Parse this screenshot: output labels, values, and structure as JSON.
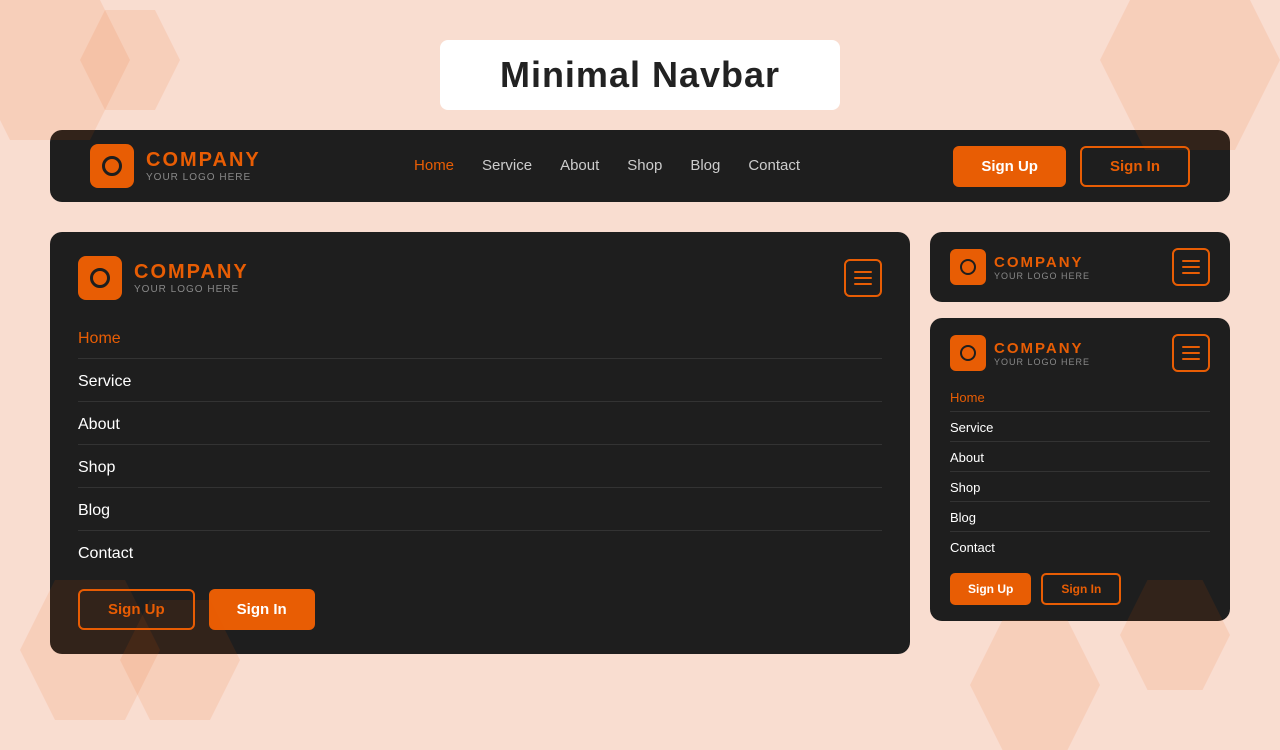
{
  "page": {
    "title": "Minimal Navbar",
    "background": "#f9ddd0"
  },
  "brand": {
    "name": "COMPANY",
    "sub": "YOUR LOGO HERE"
  },
  "nav": {
    "links": [
      {
        "label": "Home",
        "active": true
      },
      {
        "label": "Service",
        "active": false
      },
      {
        "label": "About",
        "active": false
      },
      {
        "label": "Shop",
        "active": false
      },
      {
        "label": "Blog",
        "active": false
      },
      {
        "label": "Contact",
        "active": false
      }
    ],
    "signup": "Sign Up",
    "signin": "Sign In"
  },
  "mobile_nav": {
    "links": [
      "Home",
      "Service",
      "About",
      "Shop",
      "Blog",
      "Contact"
    ]
  },
  "colors": {
    "orange": "#e85d04",
    "dark": "#1e1e1e"
  }
}
